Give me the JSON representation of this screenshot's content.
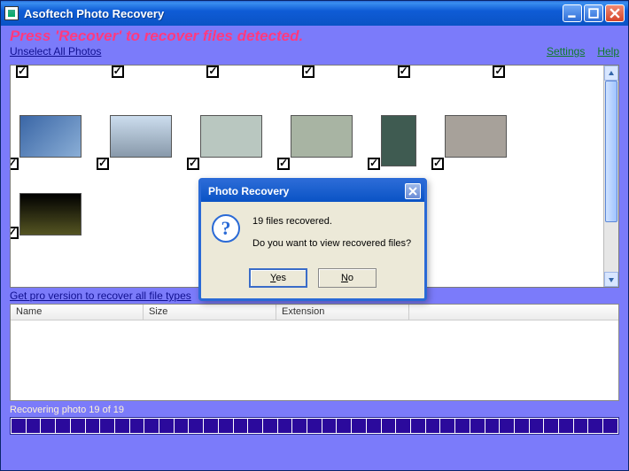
{
  "window": {
    "title": "Asoftech Photo Recovery"
  },
  "header": {
    "instruction": "Press 'Recover' to recover files detected.",
    "unselect_link": "Unselect All Photos",
    "settings_link": "Settings",
    "help_link": "Help"
  },
  "thumbnails": {
    "row1_checks": [
      true,
      true,
      true,
      true,
      true,
      true
    ],
    "row2": [
      {
        "checked": true
      },
      {
        "checked": true
      },
      {
        "checked": true
      },
      {
        "checked": true
      },
      {
        "checked": true
      },
      {
        "checked": true
      }
    ],
    "row3": [
      {
        "checked": true
      }
    ]
  },
  "pro_link": "Get pro version to recover all file types",
  "table": {
    "columns": {
      "name": "Name",
      "size": "Size",
      "ext": "Extension"
    }
  },
  "status": "Recovering photo 19 of 19",
  "progress": {
    "segments": 41
  },
  "dialog": {
    "title": "Photo Recovery",
    "line1": "19 files recovered.",
    "line2": "Do you want to view recovered files?",
    "yes": "Yes",
    "no": "No"
  }
}
